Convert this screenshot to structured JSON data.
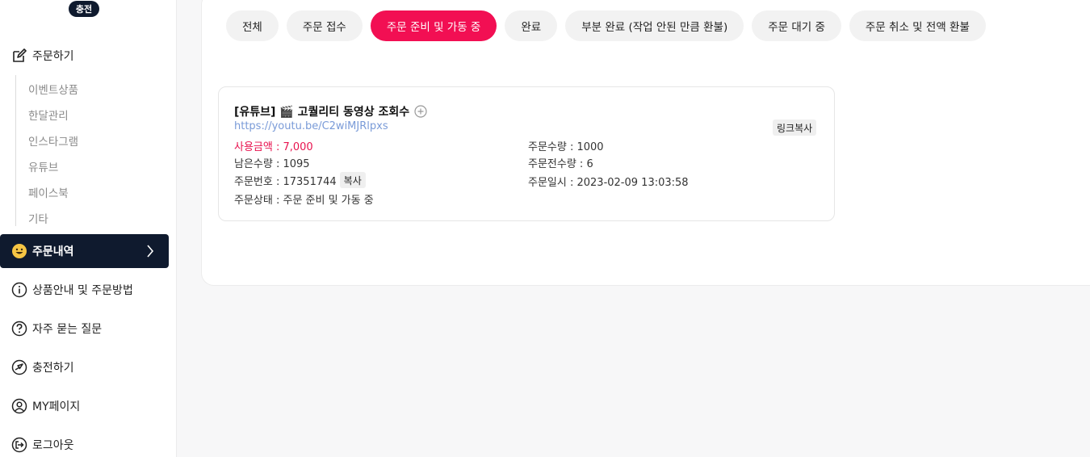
{
  "sidebar": {
    "charge_badge": "충전",
    "order_menu": "주문하기",
    "sub_items": [
      "이벤트상품",
      "한달관리",
      "인스타그램",
      "유튜브",
      "페이스북",
      "기타"
    ],
    "history": "주문내역",
    "guide": "상품안내 및 주문방법",
    "faq": "자주 묻는 질문",
    "charge": "충전하기",
    "mypage": "MY페이지",
    "logout": "로그아웃"
  },
  "tabs": [
    {
      "label": "전체"
    },
    {
      "label": "주문 접수"
    },
    {
      "label": "주문 준비 및 가동 중",
      "active": true
    },
    {
      "label": "완료"
    },
    {
      "label": "부분 완료 (작업 안된 만큼 환불)"
    },
    {
      "label": "주문 대기 중"
    },
    {
      "label": "주문 취소 및 전액 환불"
    }
  ],
  "order": {
    "title": "[유튜브] 🎬 고퀄리티 동영상 조회수",
    "link": "https://youtu.be/C2wiMJRlpxs",
    "copy_link_label": "링크복사",
    "amount": "사용금액 : 7,000",
    "quantity": "주문수량 : 1000",
    "remaining": "남은수량 : 1095",
    "before_qty": "주문전수량 : 6",
    "order_no": "주문번호 : 17351744",
    "copy_label": "복사",
    "order_date": "주문일시 : 2023-02-09 13:03:58",
    "status": "주문상태 : 주문 준비 및 가동 중"
  },
  "colors": {
    "accent": "#f20f53",
    "navy": "#0f1a2e",
    "link": "#7a9bd8"
  }
}
